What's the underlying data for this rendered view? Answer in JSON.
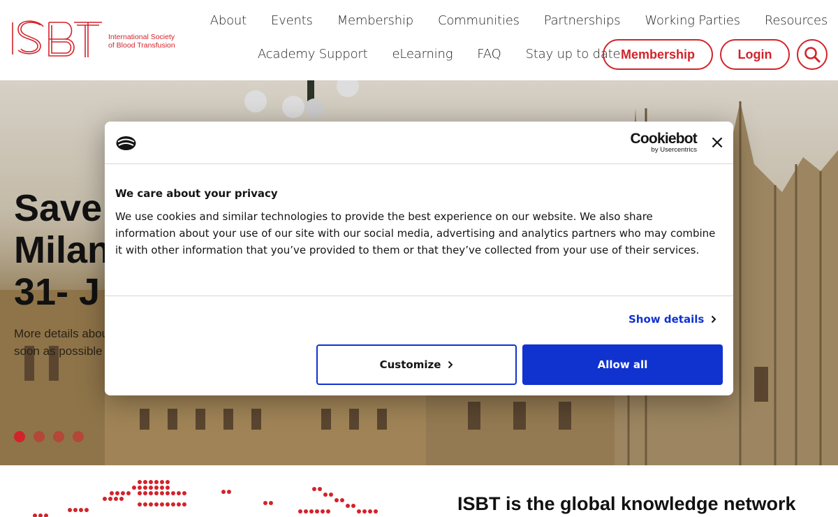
{
  "header": {
    "logo_text_line1": "International Society",
    "logo_text_line2": "of Blood Transfusion",
    "nav_primary": [
      "About",
      "Events",
      "Membership",
      "Communities",
      "Partnerships",
      "Working Parties",
      "Resources"
    ],
    "nav_secondary": [
      "Academy Support",
      "eLearning",
      "FAQ",
      "Stay up to date"
    ],
    "membership_button": "Membership",
    "login_button": "Login",
    "search_icon": "search-icon"
  },
  "hero": {
    "title_line1": "Save",
    "title_line2": "Milan",
    "title_line3": "31- J",
    "subtitle_line1": "More details abou",
    "subtitle_line2": "soon as possible",
    "slides": 4,
    "active_slide": 1
  },
  "cookie_dialog": {
    "brand": "Cookiebot",
    "brand_sub": "by Usercentrics",
    "close_icon": "close-icon",
    "heading": "We care about your privacy",
    "body": "We use cookies and similar technologies to provide the best experience on our website. We also share information about your use of our site with our social media, advertising and analytics partners who may combine it with other information that you’ve provided to them or that they’ve collected from your use of their services.",
    "show_details": "Show details",
    "customize": "Customize",
    "allow_all": "Allow all"
  },
  "main": {
    "heading": "ISBT is the global knowledge network"
  },
  "colors": {
    "brand_red": "#d2232a",
    "cookie_blue": "#1032cf"
  }
}
